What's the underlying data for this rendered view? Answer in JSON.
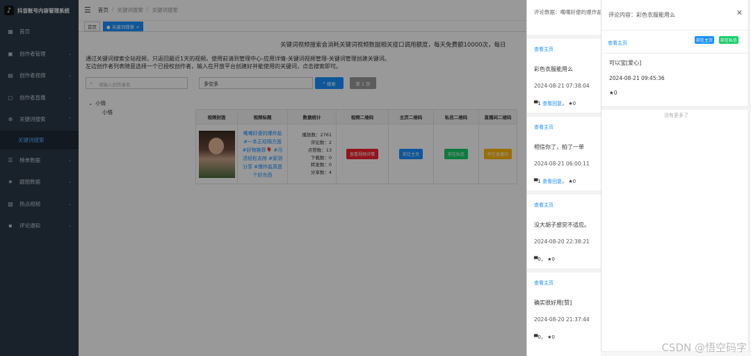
{
  "app": {
    "title": "抖音账号内容管理系统"
  },
  "sidebar": {
    "items": [
      {
        "label": "首页",
        "icon": "dashboard-icon"
      },
      {
        "label": "创作者管理",
        "icon": "user-icon"
      },
      {
        "label": "创作者视频",
        "icon": "video-icon"
      },
      {
        "label": "创作者直播",
        "icon": "live-icon"
      },
      {
        "label": "关键词搜索",
        "icon": "search-icon"
      },
      {
        "label": "关键词搜索",
        "icon": "sub-item"
      },
      {
        "label": "榜单数据",
        "icon": "list-icon"
      },
      {
        "label": "题图数据",
        "icon": "star-icon"
      },
      {
        "label": "热点视频",
        "icon": "fire-icon"
      },
      {
        "label": "评论通知",
        "icon": "comment-icon"
      }
    ]
  },
  "header": {
    "breadcrumb": [
      "首页",
      "关键词搜索",
      "关键词搜索"
    ]
  },
  "tabs": [
    {
      "label": "首页"
    },
    {
      "label": "关键词搜索"
    }
  ],
  "main": {
    "notice": "关键词视频搜索会消耗关键词视频数据相关接口调用额度，每天免费额10000次，每日",
    "intro_line1": "通过关键词搜索全站视频，只返回最近1天的视频。使用前请到管理中心-应用详情-关键词视频管理-关键词管理创建关键词。",
    "intro_line2": "左边创作者列表随意选择一个已授权创作者，输入在开放平台创建好并能使用的关键词，点击搜索即可。",
    "author_search_placeholder": "请输入创作者名",
    "keyword_value": "多空多",
    "search_button": "搜索",
    "page_button": "第 1 页",
    "tree": {
      "parent": "小情",
      "child": "小悟"
    }
  },
  "table": {
    "headers": [
      "视频封面",
      "视频标题",
      "数据统计",
      "视频二维码",
      "主页二维码",
      "私信二维码",
      "直播间二维码"
    ],
    "row": {
      "title": "嘴嘴好便的爆炸盐#一本正经隔方面#好物推荐🎈 #污渍轻松去除 #家测分享 #爆炸盐真是个好东西",
      "stats": [
        "播放数：2761",
        "评论数：2",
        "点赞数：13",
        "下载数：0",
        "转发数：0",
        "分享数：4"
      ],
      "btn_video": "查看视频详情",
      "btn_home": "前往主页",
      "btn_msg": "前往私信",
      "btn_live": "前往直播间"
    }
  },
  "comments_drawer": {
    "header": "评论数据：嘴嘴好便的爆炸盐 轻松去除 #家测分享 #爆",
    "view_home": "查看主页",
    "items": [
      {
        "text": "彩色衣服能用么",
        "date": "2024-08-21 07:38:04",
        "count": "1",
        "reply": "查看回复",
        "likes": "0"
      },
      {
        "text": "相信你了，拍了一单",
        "date": "2024-08-21 06:00:11",
        "count": "1",
        "reply": "查看回复",
        "likes": "0"
      },
      {
        "text": "没大胡子感觉不适应。",
        "date": "2024-08-20 22:38:21",
        "count": "0",
        "reply": "",
        "likes": "0"
      },
      {
        "text": "确实很好用[赞]",
        "date": "2024-08-20 21:37:44",
        "count": "0",
        "reply": "",
        "likes": "0"
      }
    ]
  },
  "reply_drawer": {
    "title": "评论内容：彩色衣服能用么",
    "view_home": "查看主页",
    "btn_home": "前往主页",
    "btn_msg": "前往私信",
    "reply": {
      "text": "可以宝[爱心]",
      "date": "2024-08-21 09:45:36",
      "likes": "0"
    },
    "no_more": "没有更多了"
  },
  "watermark": "CSDN @悟空码字",
  "colors": {
    "sidebar_bg": "#2b3a49",
    "primary": "#1890ff",
    "red": "#f5222d",
    "green": "#13ce66",
    "yellow": "#ffb800"
  }
}
